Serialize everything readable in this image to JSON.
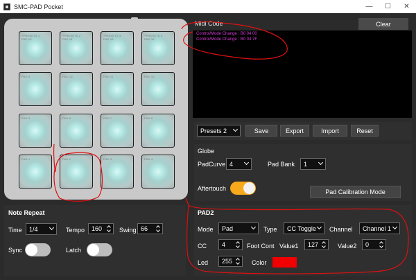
{
  "window": {
    "title": "SMC-PAD Pocket",
    "controls": [
      "—",
      "☐",
      "✕"
    ]
  },
  "pads": [
    {
      "label": "+PRESETS 1\nPAD 13"
    },
    {
      "label": "+PRESETS 2\nPAD 14"
    },
    {
      "label": "-PRESETS 3\nPAD 15"
    },
    {
      "label": "+PRESETS 4\nPAD 16"
    },
    {
      "label": "PAD 9"
    },
    {
      "label": "PAD 10"
    },
    {
      "label": "PAD 11"
    },
    {
      "label": "PAD 12"
    },
    {
      "label": "PAD 5"
    },
    {
      "label": "PAD 6"
    },
    {
      "label": "PAD 7"
    },
    {
      "label": "PAD 8"
    },
    {
      "label": "PAD 1"
    },
    {
      "label": "PAD 2"
    },
    {
      "label": "PAD 3"
    },
    {
      "label": "PAD 4"
    }
  ],
  "midi": {
    "title": "Midi Code",
    "clear_label": "Clear",
    "lines": [
      "Control/Mode Change : B0 04 00",
      "Control/Mode Change : B0 04 7F"
    ],
    "line_color": "#d63bd6"
  },
  "presets": {
    "selected": "Presets 2",
    "save_label": "Save",
    "export_label": "Export",
    "import_label": "Import",
    "reset_label": "Reset"
  },
  "globe": {
    "title": "Globe",
    "padcurve_label": "PadCurve",
    "padcurve_value": "4",
    "padbank_label": "Pad Bank",
    "padbank_value": "1",
    "aftertouch_label": "Aftertouch",
    "aftertouch_on": true,
    "calibration_label": "Pad Calibration Mode",
    "toggle_on_color": "#f7a81b"
  },
  "note_repeat": {
    "title": "Note Repeat",
    "time_label": "Time",
    "time_value": "1/4",
    "tempo_label": "Tempo",
    "tempo_value": "160",
    "swing_label": "Swing",
    "swing_value": "66",
    "sync_label": "Sync",
    "latch_label": "Latch"
  },
  "pad2": {
    "title": "PAD2",
    "mode_label": "Mode",
    "mode_value": "Pad",
    "type_label": "Type",
    "type_value": "CC Toggle",
    "channel_label": "Channel",
    "channel_value": "Channel 1",
    "cc_label": "CC",
    "cc_value": "4",
    "footcont_label": "Foot Cont",
    "value1_label": "Value1",
    "value1_value": "127",
    "value2_label": "Value2",
    "value2_value": "0",
    "led_label": "Led",
    "led_value": "255",
    "color_label": "Color",
    "color_value": "#f00000"
  },
  "annotation_color": "#e01010"
}
